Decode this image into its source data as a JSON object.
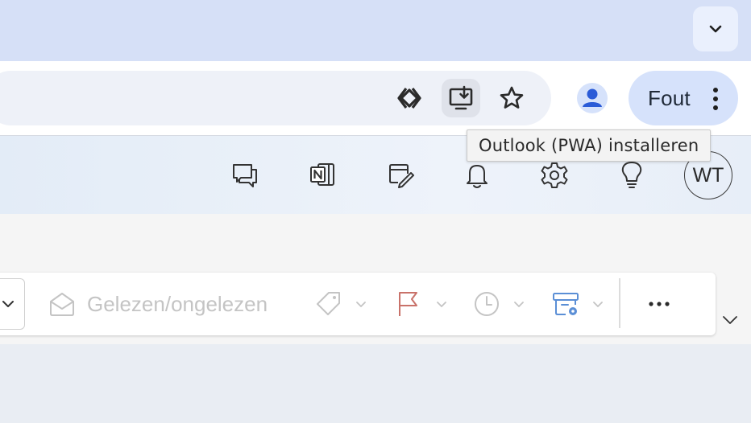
{
  "browser": {
    "tab_dropdown_icon": "chevron-down-icon",
    "toolbar": {
      "icons": [
        "extension-diamond-icon",
        "install-app-icon",
        "bookmark-star-icon",
        "profile-person-icon",
        "more-vert-icon"
      ],
      "profile_chip_label": "Fout"
    },
    "tooltip": "Outlook (PWA) installeren"
  },
  "outlook_header": {
    "icons": [
      "feedback-chat-icon",
      "onenote-icon",
      "my-day-icon",
      "notifications-bell-icon",
      "settings-gear-icon",
      "tips-lightbulb-icon"
    ],
    "avatar_initials": "WT"
  },
  "mail_toolbar": {
    "read_unread_label": "Gelezen/ongelezen",
    "items": [
      "tag-icon",
      "flag-icon",
      "snooze-clock-icon",
      "archive-rules-icon",
      "more-dots-icon"
    ],
    "colors": {
      "flag": "#c9726a",
      "archive": "#5b8fd6",
      "disabled": "#c4c4c4"
    }
  },
  "colors": {
    "tabstrip": "#d6e0f7",
    "profile_chip": "#d6e2fb",
    "accent_blue": "#2a5bd7"
  }
}
